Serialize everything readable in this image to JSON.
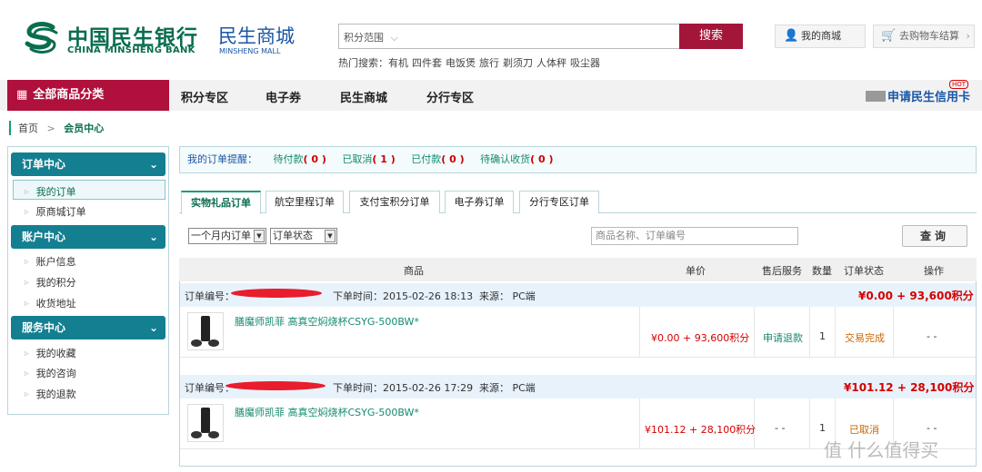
{
  "header": {
    "bank_cn": "中国民生银行",
    "bank_en": "CHINA MINSHENG BANK",
    "mall_cn": "民生商城",
    "mall_en": "MINSHENG MALL",
    "brand_color": "#0a6d4f",
    "accent_color": "#a4153a"
  },
  "search": {
    "scope": "积分范围",
    "button": "搜索",
    "hot_label": "热门搜索：",
    "hot_terms": [
      "有机",
      "四件套",
      "电饭煲",
      "旅行",
      "剃须刀",
      "人体秤",
      "吸尘器"
    ]
  },
  "top_links": {
    "my_mall": "我的商城",
    "cart": "去购物车结算"
  },
  "nav": {
    "all_categories": "全部商品分类",
    "items": [
      "积分专区",
      "电子券",
      "民生商城",
      "分行专区"
    ],
    "credit_card": "申请民生信用卡",
    "hot_badge": "HOT"
  },
  "breadcrumb": {
    "home": "首页",
    "sep": ">",
    "current": "会员中心"
  },
  "sidebar": {
    "sections": [
      {
        "title": "订单中心",
        "items": [
          "我的订单",
          "原商城订单"
        ]
      },
      {
        "title": "账户中心",
        "items": [
          "账户信息",
          "我的积分",
          "收货地址"
        ]
      },
      {
        "title": "服务中心",
        "items": [
          "我的收藏",
          "我的咨询",
          "我的退款"
        ]
      }
    ],
    "active_item": "我的订单"
  },
  "reminder": {
    "label": "我的订单提醒：",
    "items": [
      {
        "label": "待付款",
        "count": "( 0 )"
      },
      {
        "label": "已取消",
        "count": "( 1 )"
      },
      {
        "label": "已付款",
        "count": "( 0 )"
      },
      {
        "label": "待确认收货",
        "count": "( 0 )"
      }
    ]
  },
  "tabs": [
    "实物礼品订单",
    "航空里程订单",
    "支付宝积分订单",
    "电子券订单",
    "分行专区订单"
  ],
  "filters": {
    "period": "一个月内订单",
    "status": "订单状态",
    "query_placeholder": "商品名称、订单编号",
    "query_button": "查询"
  },
  "table": {
    "headers": {
      "product": "商品",
      "price": "单价",
      "after_sale": "售后服务",
      "qty": "数量",
      "status": "订单状态",
      "action": "操作"
    },
    "orders": [
      {
        "order_no_label": "订单编号：",
        "time": "下单时间：2015-02-26 18:13",
        "source": "来源： PC端",
        "total": "¥0.00 + 93,600积分",
        "product": "膳魔师凯菲 高真空焖烧杯CSYG-500BW*",
        "price": "¥0.00 + 93,600积分",
        "after_sale": "申请退款",
        "qty": "1",
        "status": "交易完成",
        "action": "- -"
      },
      {
        "order_no_label": "订单编号：",
        "time": "下单时间：2015-02-26 17:29",
        "source": "来源： PC端",
        "total": "¥101.12 + 28,100积分",
        "product": "膳魔师凯菲 高真空焖烧杯CSYG-500BW*",
        "price": "¥101.12 + 28,100积分",
        "after_sale": "- -",
        "qty": "1",
        "status": "已取消",
        "action": "- -"
      }
    ]
  },
  "watermark": "值 什么值得买"
}
